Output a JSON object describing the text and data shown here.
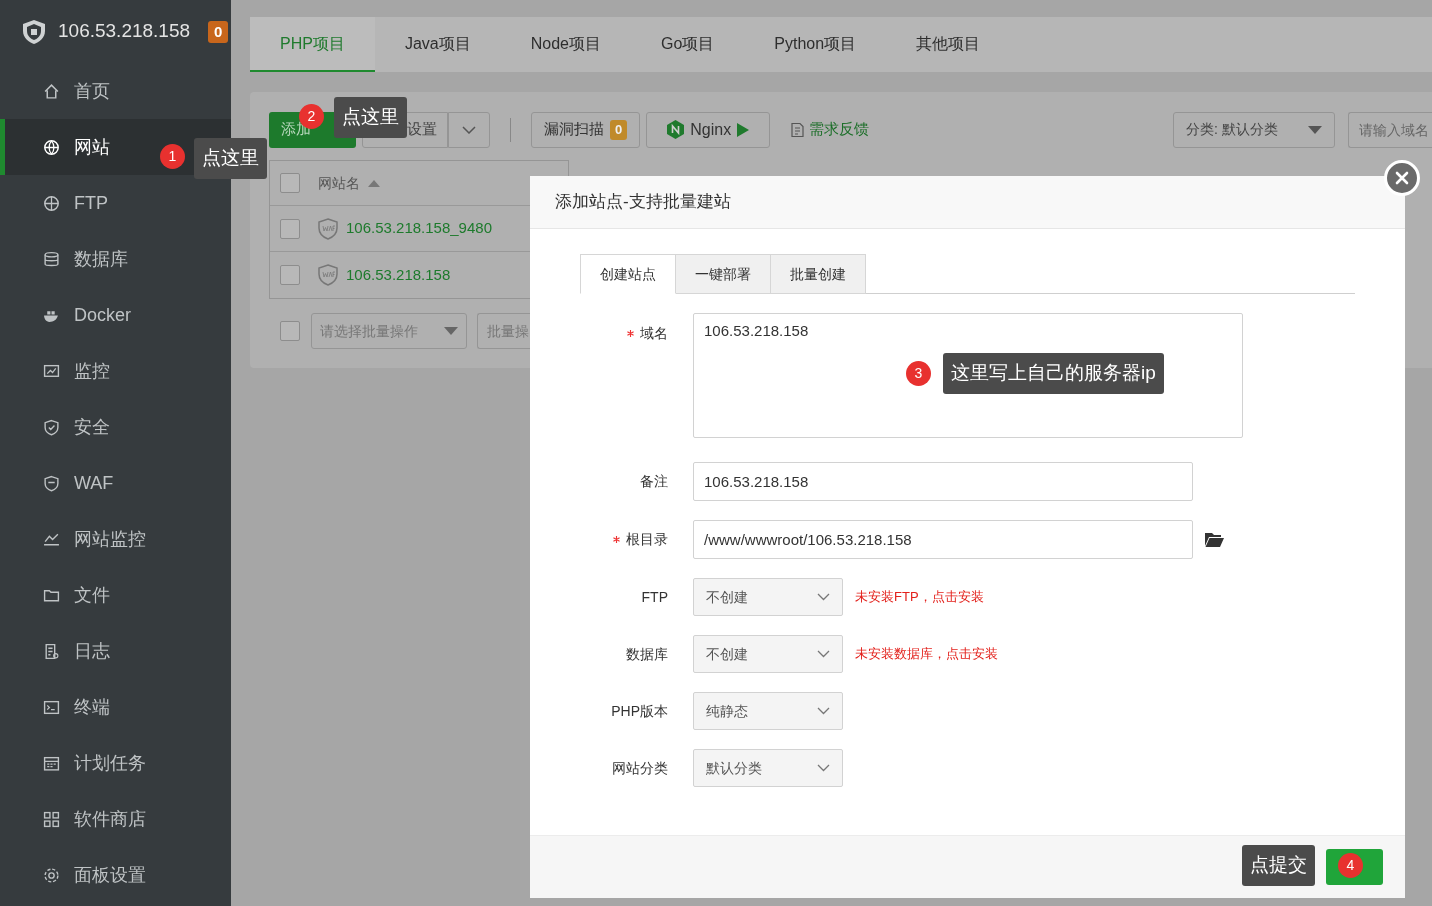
{
  "sidebar": {
    "host": "106.53.218.158",
    "alert_count": "0",
    "items": [
      {
        "label": "首页",
        "selected": false
      },
      {
        "label": "网站",
        "selected": true
      },
      {
        "label": "FTP",
        "selected": false
      },
      {
        "label": "数据库",
        "selected": false
      },
      {
        "label": "Docker",
        "selected": false
      },
      {
        "label": "监控",
        "selected": false
      },
      {
        "label": "安全",
        "selected": false
      },
      {
        "label": "WAF",
        "selected": false
      },
      {
        "label": "网站监控",
        "selected": false
      },
      {
        "label": "文件",
        "selected": false
      },
      {
        "label": "日志",
        "selected": false
      },
      {
        "label": "终端",
        "selected": false
      },
      {
        "label": "计划任务",
        "selected": false
      },
      {
        "label": "软件商店",
        "selected": false
      },
      {
        "label": "面板设置",
        "selected": false
      }
    ]
  },
  "project_tabs": [
    {
      "label": "PHP项目",
      "selected": true
    },
    {
      "label": "Java项目",
      "selected": false
    },
    {
      "label": "Node项目",
      "selected": false
    },
    {
      "label": "Go项目",
      "selected": false
    },
    {
      "label": "Python项目",
      "selected": false
    },
    {
      "label": "其他项目",
      "selected": false
    }
  ],
  "toolbar": {
    "add_site": "添加",
    "advanced": "设置",
    "scan": "漏洞扫描",
    "scan_count": "0",
    "nginx": "Nginx",
    "feedback": "需求反馈",
    "category": "分类: 默认分类",
    "search_placeholder": "请输入域名"
  },
  "table": {
    "columns": [
      "网站名"
    ],
    "header_checked": false,
    "rows": [
      {
        "name": "106.53.218.158_9480",
        "checked": false
      },
      {
        "name": "106.53.218.158",
        "checked": false
      }
    ],
    "batch_checked": false,
    "batch_placeholder": "请选择批量操作",
    "batch_button": "批量操"
  },
  "dialog": {
    "title": "添加站点-支持批量建站",
    "tabs": [
      {
        "label": "创建站点",
        "selected": true
      },
      {
        "label": "一键部署",
        "selected": false
      },
      {
        "label": "批量创建",
        "selected": false
      }
    ],
    "fields": [
      {
        "kind": "textarea",
        "label": "域名",
        "required": true,
        "value": "106.53.218.158"
      },
      {
        "kind": "input",
        "label": "备注",
        "required": false,
        "value": "106.53.218.158"
      },
      {
        "kind": "path",
        "label": "根目录",
        "required": true,
        "value": "/www/wwwroot/106.53.218.158"
      },
      {
        "kind": "select",
        "label": "FTP",
        "required": false,
        "value": "不创建",
        "warning": "未安装FTP，点击安装"
      },
      {
        "kind": "select",
        "label": "数据库",
        "required": false,
        "value": "不创建",
        "warning": "未安装数据库，点击安装"
      },
      {
        "kind": "select",
        "label": "PHP版本",
        "required": false,
        "value": "纯静态"
      },
      {
        "kind": "select",
        "label": "网站分类",
        "required": false,
        "value": "默认分类"
      }
    ]
  },
  "callouts": [
    {
      "number": "1",
      "text": "点这里"
    },
    {
      "number": "2",
      "text": "点这里"
    },
    {
      "number": "3",
      "text": "这里写上自己的服务器ip"
    },
    {
      "number": "4",
      "text": "点提交"
    }
  ]
}
